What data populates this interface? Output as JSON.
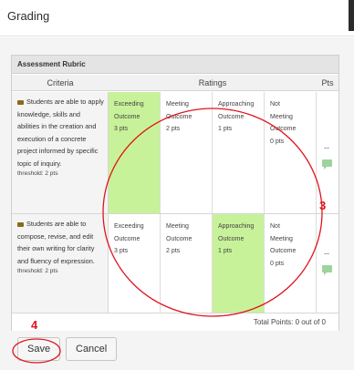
{
  "dialog": {
    "title": "Grading"
  },
  "rubric": {
    "title": "Assessment Rubric",
    "headers": {
      "criteria": "Criteria",
      "ratings": "Ratings",
      "pts": "Pts"
    },
    "rows": [
      {
        "criterion": "Students are able to apply knowledge, skills and abilities in the creation and execution of a concrete project informed by specific topic of inquiry.",
        "threshold": "threshold: 2 pts",
        "ratings": [
          {
            "lines": [
              "Exceeding",
              "Outcome",
              "3 pts"
            ],
            "selected": true
          },
          {
            "lines": [
              "Meeting",
              "Outcome",
              "2 pts"
            ],
            "selected": false
          },
          {
            "lines": [
              "Approaching",
              "Outcome",
              "1 pts"
            ],
            "selected": false
          },
          {
            "lines": [
              "Not",
              "Meeting",
              "Outcome",
              "0 pts"
            ],
            "selected": false
          }
        ],
        "pts": "--"
      },
      {
        "criterion": "Students are able to compose, revise, and edit their own writing for clarity and fluency of expression.",
        "threshold": "threshold: 2 pts",
        "ratings": [
          {
            "lines": [
              "Exceeding",
              "Outcome",
              "3 pts"
            ],
            "selected": false
          },
          {
            "lines": [
              "Meeting",
              "Outcome",
              "2 pts"
            ],
            "selected": false
          },
          {
            "lines": [
              "Approaching",
              "Outcome",
              "1 pts"
            ],
            "selected": true
          },
          {
            "lines": [
              "Not",
              "Meeting",
              "Outcome",
              "0 pts"
            ],
            "selected": false
          }
        ],
        "pts": "--"
      }
    ],
    "total": "Total Points: 0 out of 0"
  },
  "annotations": {
    "step3": "3",
    "step4": "4"
  },
  "footer": {
    "save_label": "Save",
    "cancel_label": "Cancel"
  },
  "colors": {
    "selected_rating": "#c8f29a",
    "annotation": "#e0141e",
    "comment_icon": "#9dd49d"
  }
}
